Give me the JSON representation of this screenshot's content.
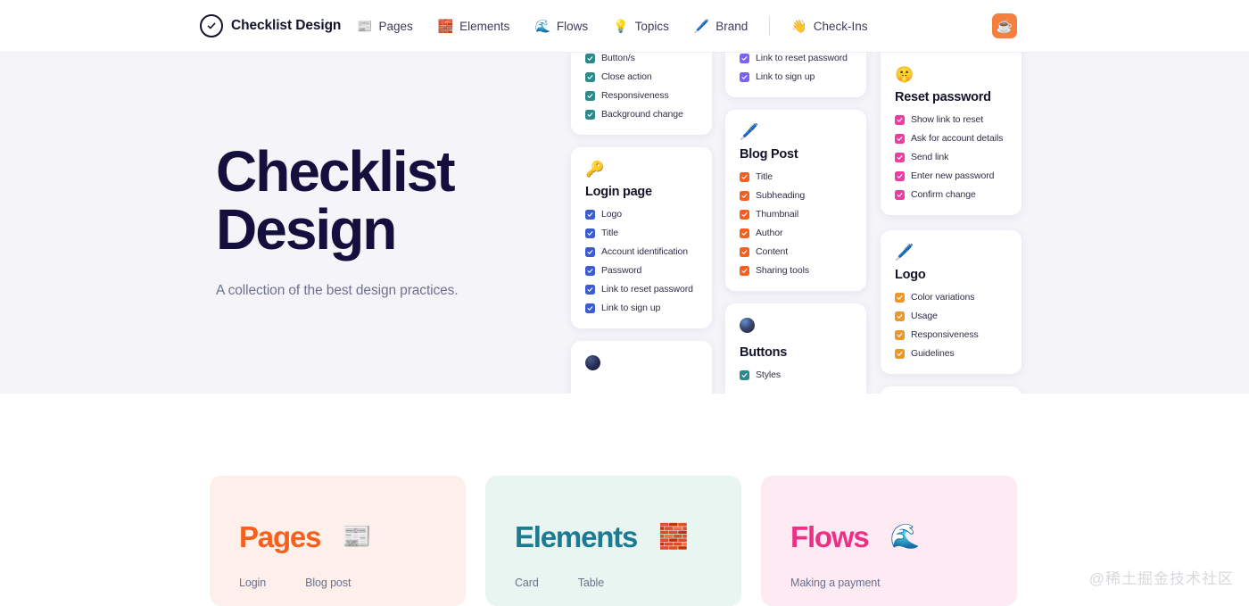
{
  "nav": {
    "brand": {
      "icon": "check-circle-icon",
      "name": "Checklist Design"
    },
    "links": [
      {
        "emoji": "📰",
        "icon": "newspaper-icon",
        "label": "Pages"
      },
      {
        "emoji": "🧱",
        "icon": "brick-icon",
        "label": "Elements"
      },
      {
        "emoji": "🌊",
        "icon": "wave-icon",
        "label": "Flows"
      },
      {
        "emoji": "💡",
        "icon": "lightbulb-icon",
        "label": "Topics"
      },
      {
        "emoji": "🖊️",
        "icon": "pen-icon",
        "label": "Brand"
      },
      {
        "emoji": "👋",
        "icon": "waving-hand-icon",
        "label": "Check-Ins"
      }
    ],
    "action": {
      "emoji": "☕",
      "icon": "coffee-cup-icon",
      "color": "#f5803e"
    }
  },
  "hero": {
    "title_line1": "Checklist",
    "title_line2": "Design",
    "subtitle": "A collection of the best design practices."
  },
  "board": {
    "columns": [
      {
        "cards": [
          {
            "clipped": true,
            "emoji": "",
            "title": "",
            "accent": "#2e8a8a",
            "items": [
              "Button/s",
              "Close action",
              "Responsiveness",
              "Background change"
            ]
          },
          {
            "clipped": false,
            "emoji": "🔑",
            "icon": "key-icon",
            "title": "Login page",
            "accent": "#3c5ccf",
            "items": [
              "Logo",
              "Title",
              "Account identification",
              "Password",
              "Link to reset password",
              "Link to sign up"
            ]
          },
          {
            "clipped": false,
            "emoji": "🔵",
            "icon": "dark-sphere-icon",
            "title": "",
            "accent": "#2e8a8a",
            "items": []
          }
        ]
      },
      {
        "cards": [
          {
            "clipped": true,
            "emoji": "",
            "title": "",
            "accent": "#7b61ff",
            "items": [
              "Link to reset password",
              "Link to sign up"
            ]
          },
          {
            "clipped": false,
            "emoji": "🖊️",
            "icon": "pen-icon",
            "title": "Blog Post",
            "accent": "#f5601e",
            "items": [
              "Title",
              "Subheading",
              "Thumbnail",
              "Author",
              "Content",
              "Sharing tools"
            ]
          },
          {
            "clipped": false,
            "emoji": "🔮",
            "icon": "dark-sphere-icon",
            "title": "Buttons",
            "accent": "#2e8a8a",
            "items": [
              "Styles"
            ]
          }
        ]
      },
      {
        "cards": [
          {
            "clipped": false,
            "emoji": "🤫",
            "icon": "shushing-face-icon",
            "title": "Reset password",
            "accent": "#ef3ba2",
            "items": [
              "Show link to reset",
              "Ask for account details",
              "Send link",
              "Enter new password",
              "Confirm change"
            ]
          },
          {
            "clipped": false,
            "emoji": "🖊️",
            "icon": "blue-pen-icon",
            "title": "Logo",
            "accent": "#eb9829",
            "items": [
              "Color variations",
              "Usage",
              "Responsiveness",
              "Guidelines"
            ]
          },
          {
            "clipped": false,
            "emoji": "",
            "title": "",
            "accent": "#2e8a8a",
            "items": []
          }
        ]
      }
    ]
  },
  "categories": [
    {
      "name": "Pages",
      "emoji": "📰",
      "icon": "newspaper-icon",
      "bg": "#fdefe9",
      "color": "#f5601e",
      "links": [
        "Login",
        "Blog post"
      ]
    },
    {
      "name": "Elements",
      "emoji": "🧱",
      "icon": "brick-icon",
      "bg": "#e8f5f1",
      "color": "#1b7b92",
      "links": [
        "Card",
        "Table"
      ]
    },
    {
      "name": "Flows",
      "emoji": "🌊",
      "icon": "wave-icon",
      "bg": "#fdeaf2",
      "color": "#ed2f86",
      "links": [
        "Making a payment"
      ]
    }
  ],
  "watermark": "@稀土掘金技术社区"
}
